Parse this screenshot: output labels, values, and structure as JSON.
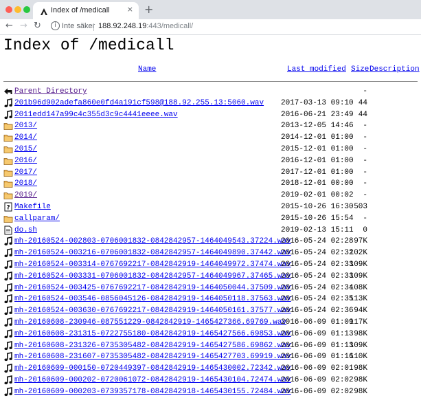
{
  "browser": {
    "tab_title": "Index of /medicall",
    "tab_close": "×",
    "new_tab": "+",
    "back": "←",
    "forward": "→",
    "reload": "↻",
    "info": "i",
    "security_label": "Inte säker",
    "url_host": "188.92.248.19",
    "url_rest": ":443/medicall/"
  },
  "page": {
    "title": "Index of /medicall",
    "headers": {
      "name": "Name",
      "last_modified": "Last modified",
      "size": "Size",
      "description": "Description"
    },
    "entries": [
      {
        "name": "Parent Directory",
        "date": "",
        "size": "-",
        "icon": "back-arrow-icon",
        "visited": true
      },
      {
        "name": "201b96d902adefa860e0fd4a191cf598@188.92.255.13:5060.wav",
        "date": "2017-03-13 09:10",
        "size": "44",
        "icon": "music-note-icon"
      },
      {
        "name": "2011edd147a99c4c355d3c9c4441eeee.wav",
        "date": "2016-06-21 23:49",
        "size": "44",
        "icon": "music-note-icon"
      },
      {
        "name": "2013/",
        "date": "2013-12-05 14:46",
        "size": "-",
        "icon": "folder-icon"
      },
      {
        "name": "2014/",
        "date": "2014-12-01 01:00",
        "size": "-",
        "icon": "folder-icon"
      },
      {
        "name": "2015/",
        "date": "2015-12-01 01:00",
        "size": "-",
        "icon": "folder-icon"
      },
      {
        "name": "2016/",
        "date": "2016-12-01 01:00",
        "size": "-",
        "icon": "folder-icon"
      },
      {
        "name": "2017/",
        "date": "2017-12-01 01:00",
        "size": "-",
        "icon": "folder-icon"
      },
      {
        "name": "2018/",
        "date": "2018-12-01 00:00",
        "size": "-",
        "icon": "folder-icon"
      },
      {
        "name": "2019/",
        "date": "2019-02-01 00:02",
        "size": "-",
        "icon": "folder-icon",
        "visited": true
      },
      {
        "name": "Makefile",
        "date": "2015-10-26 16:30",
        "size": "503",
        "icon": "unknown-file-icon"
      },
      {
        "name": "callparam/",
        "date": "2015-10-26 15:54",
        "size": "-",
        "icon": "folder-icon"
      },
      {
        "name": "do.sh",
        "date": "2019-02-13 15:11",
        "size": "0",
        "icon": "text-file-icon"
      },
      {
        "name": "mh-20160524-002803-0706001832-0842842957-1464049543.37224.wav",
        "date": "2016-05-24 02:28",
        "size": "97K",
        "icon": "music-note-icon"
      },
      {
        "name": "mh-20160524-003216-0706001832-0842842957-1464049890.37442.wav",
        "date": "2016-05-24 02:32",
        "size": "102K",
        "icon": "music-note-icon"
      },
      {
        "name": "mh-20160524-003314-0767692217-0842842919-1464049972.37474.wav",
        "date": "2016-05-24 02:33",
        "size": "109K",
        "icon": "music-note-icon"
      },
      {
        "name": "mh-20160524-003331-0706001832-0842842957-1464049967.37465.wav",
        "date": "2016-05-24 02:33",
        "size": "109K",
        "icon": "music-note-icon"
      },
      {
        "name": "mh-20160524-003425-0767692217-0842842919-1464050044.37509.wav",
        "date": "2016-05-24 02:34",
        "size": "108K",
        "icon": "music-note-icon"
      },
      {
        "name": "mh-20160524-003546-0856045126-0842842919-1464050118.37563.wav",
        "date": "2016-05-24 02:35",
        "size": "113K",
        "icon": "music-note-icon"
      },
      {
        "name": "mh-20160524-003630-0767692217-0842842919-1464050161.37577.wav",
        "date": "2016-05-24 02:36",
        "size": "94K",
        "icon": "music-note-icon"
      },
      {
        "name": "mh-20160608-230946-087551229-0842842919-1465427366.69769.wav",
        "date": "2016-06-09 01:09",
        "size": "117K",
        "icon": "music-note-icon"
      },
      {
        "name": "mh-20160608-231315-0722755180-0842842919-1465427566.69853.wav",
        "date": "2016-06-09 01:13",
        "size": "98K",
        "icon": "music-note-icon"
      },
      {
        "name": "mh-20160608-231326-0735305482-0842842919-1465427586.69862.wav",
        "date": "2016-06-09 01:13",
        "size": "109K",
        "icon": "music-note-icon"
      },
      {
        "name": "mh-20160608-231607-0735305482-0842842919-1465427703.69919.wav",
        "date": "2016-06-09 01:16",
        "size": "110K",
        "icon": "music-note-icon"
      },
      {
        "name": "mh-20160609-000150-0720449397-0842842919-1465430002.72342.wav",
        "date": "2016-06-09 02:01",
        "size": "98K",
        "icon": "music-note-icon"
      },
      {
        "name": "mh-20160609-000202-0720061072-0842842919-1465430104.72474.wav",
        "date": "2016-06-09 02:02",
        "size": "98K",
        "icon": "music-note-icon"
      },
      {
        "name": "mh-20160609-000203-0739357178-0842842918-1465430155.72484.wav",
        "date": "2016-06-09 02:02",
        "size": "98K",
        "icon": "music-note-icon"
      }
    ]
  }
}
